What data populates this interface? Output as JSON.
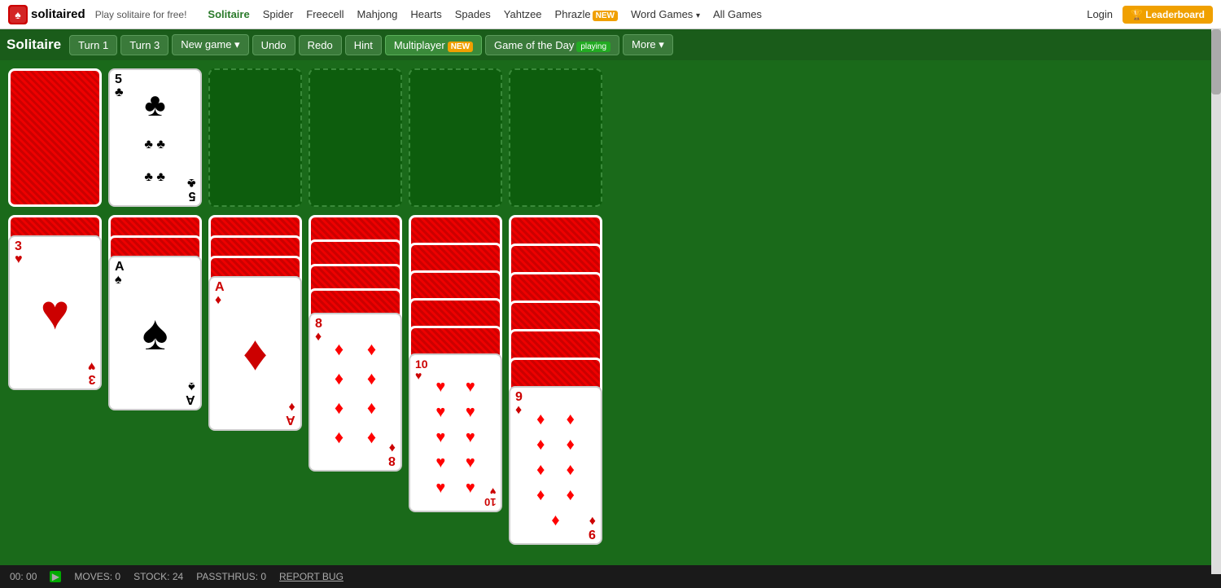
{
  "nav": {
    "logo_text": "solitaired",
    "tagline": "Play solitaire for free!",
    "links": [
      {
        "label": "Solitaire",
        "active": true
      },
      {
        "label": "Spider",
        "active": false
      },
      {
        "label": "Freecell",
        "active": false
      },
      {
        "label": "Mahjong",
        "active": false
      },
      {
        "label": "Hearts",
        "active": false
      },
      {
        "label": "Spades",
        "active": false
      },
      {
        "label": "Yahtzee",
        "active": false
      },
      {
        "label": "Phrazle",
        "active": false,
        "badge": "NEW"
      },
      {
        "label": "Word Games",
        "active": false,
        "dropdown": true
      },
      {
        "label": "All Games",
        "active": false
      }
    ],
    "login": "Login",
    "leaderboard": "🏆 Leaderboard"
  },
  "toolbar": {
    "game_title": "Solitaire",
    "turn1": "Turn 1",
    "turn3": "Turn 3",
    "new_game": "New game",
    "undo": "Undo",
    "redo": "Redo",
    "hint": "Hint",
    "multiplayer": "Multiplayer",
    "multiplayer_badge": "NEW",
    "game_of_day": "Game of the Day",
    "playing_badge": "playing",
    "more": "More"
  },
  "status": {
    "timer": "00: 00",
    "moves_label": "MOVES: 0",
    "stock_label": "STOCK: 24",
    "passthrus_label": "PASSTHRUS: 0",
    "report": "REPORT BUG"
  },
  "game": {
    "stock_card": "face-down",
    "waste_card": {
      "value": "5",
      "suit": "♣",
      "color": "black"
    },
    "tableau": [
      {
        "id": 1,
        "cards": [
          {
            "face": "down"
          },
          {
            "face": "up",
            "value": "3",
            "suit": "♥",
            "color": "red"
          }
        ]
      },
      {
        "id": 2,
        "cards": [
          {
            "face": "down"
          },
          {
            "face": "down"
          },
          {
            "face": "up",
            "value": "A",
            "suit": "♠",
            "color": "black"
          }
        ]
      },
      {
        "id": 3,
        "cards": [
          {
            "face": "down"
          },
          {
            "face": "down"
          },
          {
            "face": "down"
          },
          {
            "face": "up",
            "value": "A",
            "suit": "♦",
            "color": "red"
          }
        ]
      },
      {
        "id": 4,
        "cards": [
          {
            "face": "down"
          },
          {
            "face": "down"
          },
          {
            "face": "down"
          },
          {
            "face": "down"
          },
          {
            "face": "up",
            "value": "8",
            "suit": "♦",
            "color": "red"
          }
        ]
      },
      {
        "id": 5,
        "cards": [
          {
            "face": "down"
          },
          {
            "face": "down"
          },
          {
            "face": "down"
          },
          {
            "face": "down"
          },
          {
            "face": "down"
          },
          {
            "face": "up",
            "value": "10",
            "suit": "♥",
            "color": "red"
          }
        ]
      },
      {
        "id": 6,
        "cards": [
          {
            "face": "down"
          },
          {
            "face": "down"
          },
          {
            "face": "down"
          },
          {
            "face": "down"
          },
          {
            "face": "down"
          },
          {
            "face": "down"
          },
          {
            "face": "up",
            "value": "9",
            "suit": "♦",
            "color": "red"
          }
        ]
      }
    ]
  }
}
